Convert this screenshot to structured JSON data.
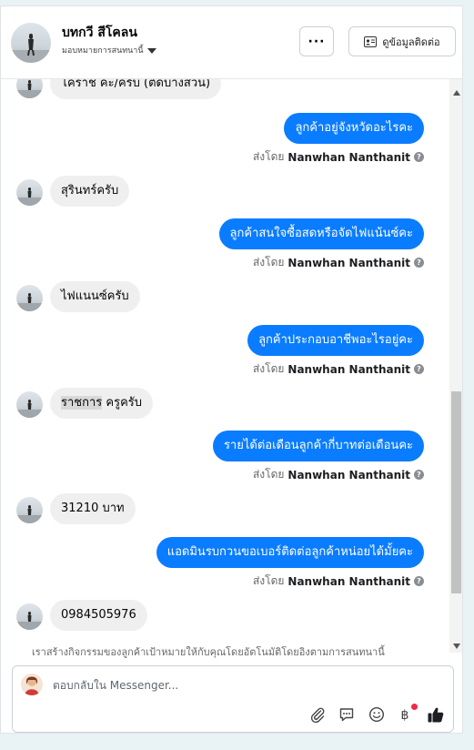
{
  "header": {
    "contact_name": "บทกวี สีโคลน",
    "assign_label": "มอบหมายการสนทนานี้",
    "more_label": "···",
    "contact_info_label": "ดูข้อมูลติดต่อ"
  },
  "messages": [
    {
      "dir": "in",
      "text": "โคราช ค่ะ/ครับ (ตัดบางส่วน)"
    },
    {
      "dir": "out",
      "text": "ลูกค้าอยู่จังหวัดอะไรคะ"
    },
    {
      "dir": "in",
      "text": "สุรินทร์ครับ"
    },
    {
      "dir": "out",
      "text": "ลูกค้าสนใจซื้อสดหรือจัดไฟแน้นซ์คะ"
    },
    {
      "dir": "in",
      "text": "ไฟแนนซ์ครับ"
    },
    {
      "dir": "out",
      "text": "ลูกค้าประกอบอาชีพอะไรอยู่คะ"
    },
    {
      "dir": "in",
      "text_hl": "ราชการ",
      "text_rest": " ครูครับ"
    },
    {
      "dir": "out",
      "text": "รายได้ต่อเดือนลูกค้ากี่บาทต่อเดือนคะ"
    },
    {
      "dir": "in",
      "text": "31210 บาท"
    },
    {
      "dir": "out",
      "text": "แอดมินรบกวนขอเบอร์ติดต่อลูกค้าหน่อยได้มั้ยคะ"
    },
    {
      "dir": "in",
      "text": "0984505976"
    }
  ],
  "sent_by": {
    "prefix": "ส่งโดย",
    "agent": "Nanwhan Nanthanit"
  },
  "notice": "เราสร้างกิจกรรมของลูกค้าเป้าหมายให้กับคุณโดยอัตโนมัติโดยอิงตามการสนทนานี้",
  "composer": {
    "placeholder": "ตอบกลับใน Messenger...",
    "icons": [
      "attachment-icon",
      "saved-reply-icon",
      "emoji-icon",
      "currency-baht-icon",
      "like-icon"
    ]
  },
  "colors": {
    "outgoing_bubble": "#0a7cff",
    "incoming_bubble": "#efefef",
    "notification_dot": "#f0284a"
  }
}
